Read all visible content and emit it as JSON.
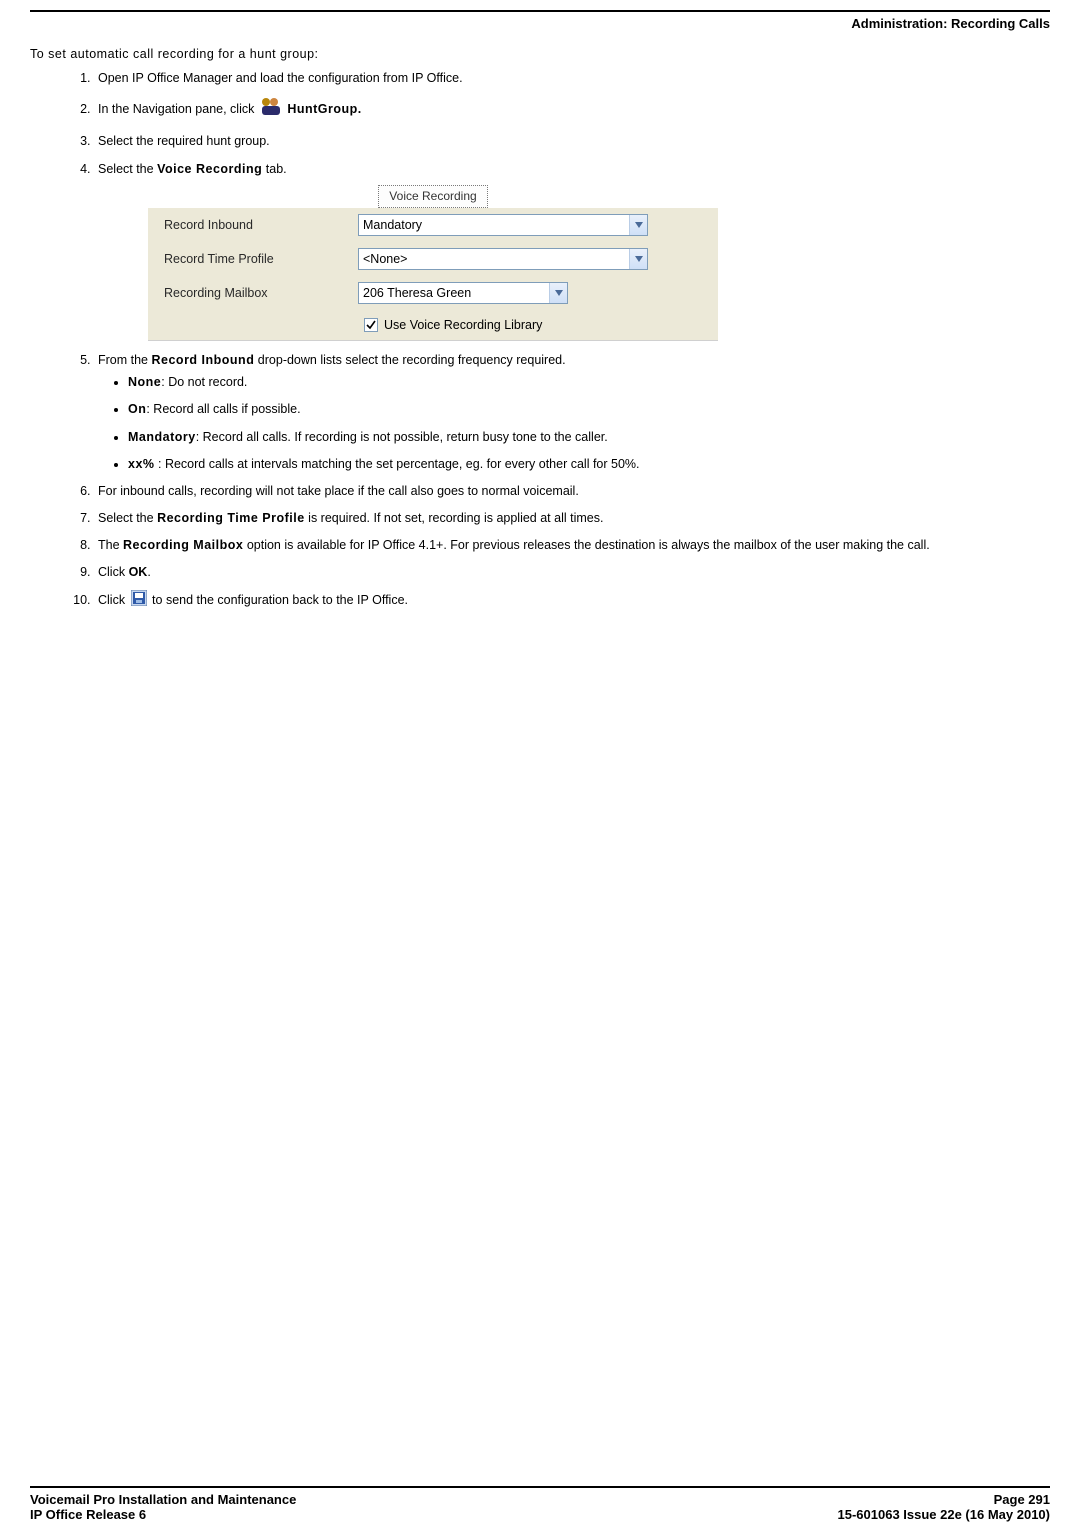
{
  "header": {
    "section_title": "Administration: Recording Calls"
  },
  "intro": "To set automatic call recording for a hunt group:",
  "steps": {
    "s1": "Open IP Office Manager and load the configuration from IP Office.",
    "s2_pre": "In the Navigation pane, click ",
    "s2_post": " HuntGroup.",
    "s3": "Select the required hunt group.",
    "s4_pre": "Select the ",
    "s4_bold": "Voice Recording",
    "s4_post": " tab."
  },
  "form": {
    "tab_label": "Voice Recording",
    "row1_label": "Record Inbound",
    "row1_value": "Mandatory",
    "row2_label": "Record Time Profile",
    "row2_value": "<None>",
    "row3_label": "Recording Mailbox",
    "row3_value": "206 Theresa Green",
    "checkbox_label": "Use Voice Recording Library"
  },
  "steps2": {
    "s5_pre": "From the ",
    "s5_bold": "Record Inbound",
    "s5_post": " drop-down lists select the recording frequency required.",
    "bullets": {
      "b1_bold": "None",
      "b1_text": ": Do not record.",
      "b2_bold": "On",
      "b2_text": ": Record all calls if possible.",
      "b3_bold": "Mandatory",
      "b3_text": ": Record all calls. If recording is not possible, return busy tone to the caller.",
      "b4_bold": "xx%",
      "b4_text": " : Record calls at intervals matching the set percentage, eg. for every other call for 50%."
    },
    "s6": "For inbound calls, recording will not take place if the call also goes to normal voicemail.",
    "s7_pre": "Select the ",
    "s7_bold": "Recording Time Profile",
    "s7_post": " is required. If not set, recording is applied at all times.",
    "s8_pre": "The ",
    "s8_bold": "Recording Mailbox",
    "s8_post": " option is available for IP Office 4.1+. For previous releases the destination is always the mailbox of the user making the call.",
    "s9_pre": "Click ",
    "s9_bold": "OK",
    "s9_post": ".",
    "s10_pre": "Click ",
    "s10_post": " to send the configuration back to the IP Office."
  },
  "footer": {
    "left1": "Voicemail Pro Installation and Maintenance",
    "left2": "IP Office Release 6",
    "right1": "Page 291",
    "right2": "15-601063 Issue 22e (16 May 2010)"
  }
}
